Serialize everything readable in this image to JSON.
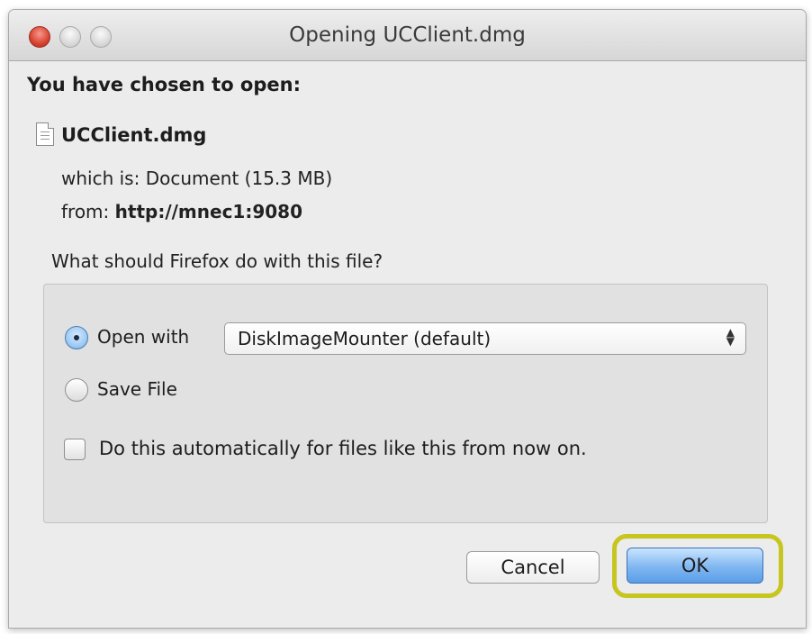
{
  "window": {
    "title": "Opening UCClient.dmg"
  },
  "dialog": {
    "heading": "You have chosen to open:",
    "filename": "UCClient.dmg",
    "which_is": "which is:  Document (15.3 MB)",
    "from_label": "from:",
    "from_url": "http://mnec1:9080",
    "question": "What should Firefox do with this file?"
  },
  "options": {
    "open_with_label": "Open with",
    "open_with_app": "DiskImageMounter (default)",
    "save_file_label": "Save File",
    "auto_label": "Do this automatically for files like this from now on.",
    "selected": "open_with",
    "auto_checked": false
  },
  "buttons": {
    "cancel": "Cancel",
    "ok": "OK"
  },
  "colors": {
    "highlight": "#c7c51f",
    "ok_button": "#6aa7e0",
    "close_button": "#d8432f"
  },
  "icons": [
    "close-window-icon",
    "minimize-window-icon",
    "zoom-window-icon",
    "file-icon",
    "select-arrows-icon"
  ]
}
